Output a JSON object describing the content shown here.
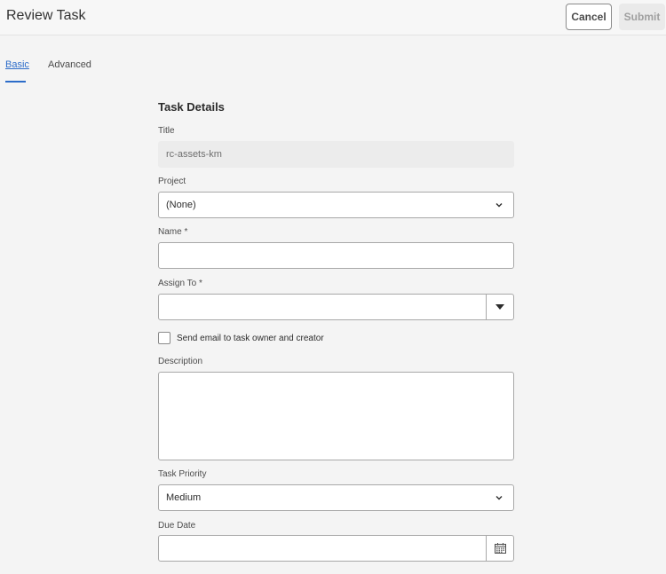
{
  "header": {
    "title": "Review Task",
    "cancel_label": "Cancel",
    "submit_label": "Submit"
  },
  "tabs": [
    {
      "label": "Basic",
      "active": true
    },
    {
      "label": "Advanced",
      "active": false
    }
  ],
  "form": {
    "section_title": "Task Details",
    "title": {
      "label": "Title",
      "value": "rc-assets-km"
    },
    "project": {
      "label": "Project",
      "value": "(None)"
    },
    "name": {
      "label": "Name *",
      "value": ""
    },
    "assign_to": {
      "label": "Assign To *",
      "value": ""
    },
    "send_email": {
      "label": "Send email to task owner and creator",
      "checked": false
    },
    "description": {
      "label": "Description",
      "value": ""
    },
    "task_priority": {
      "label": "Task Priority",
      "value": "Medium"
    },
    "due_date": {
      "label": "Due Date",
      "value": ""
    }
  },
  "icons": {
    "project_dropdown": "chevron-down-icon",
    "assign_to_dropdown": "caret-down-icon",
    "priority_dropdown": "chevron-down-icon",
    "due_date_picker": "calendar-icon"
  },
  "colors": {
    "accent": "#2c6cc9",
    "background": "#f4f4f4",
    "field_border": "#a8a8a8"
  }
}
